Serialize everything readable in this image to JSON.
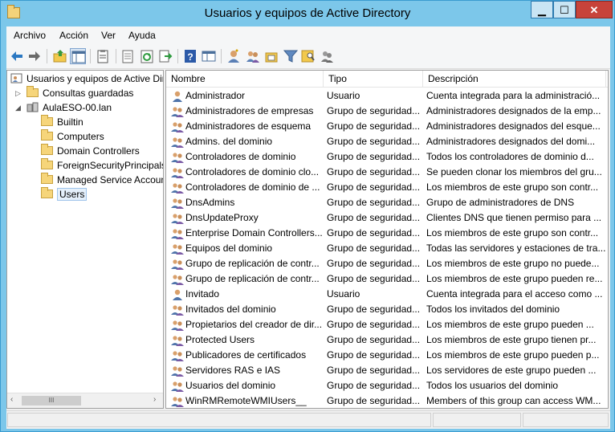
{
  "window": {
    "title": "Usuarios y equipos de Active Directory"
  },
  "menu": [
    "Archivo",
    "Acción",
    "Ver",
    "Ayuda"
  ],
  "toolbar": {
    "icons": [
      "back-icon",
      "forward-icon",
      "up-folder-icon",
      "show-tree-icon",
      "properties-icon",
      "export-list-icon",
      "refresh-icon",
      "export-icon",
      "help-icon",
      "console-icon",
      "new-user-icon",
      "new-group-icon",
      "new-ou-icon",
      "filter-icon",
      "find-icon",
      "add-to-group-icon"
    ]
  },
  "tree": {
    "root": "Usuarios y equipos de Active Dir",
    "saved_queries": "Consultas guardadas",
    "domain": "AulaESO-00.lan",
    "children": [
      "Builtin",
      "Computers",
      "Domain Controllers",
      "ForeignSecurityPrincipals",
      "Managed Service Accounts",
      "Users"
    ],
    "selected": "Users",
    "scroll_left": "‹",
    "scroll_right": "›",
    "scroll_grip": "III"
  },
  "list": {
    "columns": [
      "Nombre",
      "Tipo",
      "Descripción"
    ],
    "rows": [
      {
        "icon": "user-icon",
        "name": "Administrador",
        "type": "Usuario",
        "desc": "Cuenta integrada para la administració..."
      },
      {
        "icon": "group-icon",
        "name": "Administradores de empresas",
        "type": "Grupo de seguridad...",
        "desc": "Administradores designados de la emp..."
      },
      {
        "icon": "group-icon",
        "name": "Administradores de esquema",
        "type": "Grupo de seguridad...",
        "desc": "Administradores designados del esque..."
      },
      {
        "icon": "group-icon",
        "name": "Admins. del dominio",
        "type": "Grupo de seguridad...",
        "desc": "Administradores designados del domi..."
      },
      {
        "icon": "group-icon",
        "name": "Controladores de dominio",
        "type": "Grupo de seguridad...",
        "desc": "Todos los controladores de dominio d..."
      },
      {
        "icon": "group-icon",
        "name": "Controladores de dominio clo...",
        "type": "Grupo de seguridad...",
        "desc": "Se pueden clonar los miembros del gru..."
      },
      {
        "icon": "group-icon",
        "name": "Controladores de dominio de ...",
        "type": "Grupo de seguridad...",
        "desc": "Los miembros de este grupo son contr..."
      },
      {
        "icon": "group-icon",
        "name": "DnsAdmins",
        "type": "Grupo de seguridad...",
        "desc": "Grupo de administradores de DNS"
      },
      {
        "icon": "group-icon",
        "name": "DnsUpdateProxy",
        "type": "Grupo de seguridad...",
        "desc": "Clientes DNS que tienen permiso para ..."
      },
      {
        "icon": "group-icon",
        "name": "Enterprise Domain Controllers...",
        "type": "Grupo de seguridad...",
        "desc": "Los miembros de este grupo son contr..."
      },
      {
        "icon": "group-icon",
        "name": "Equipos del dominio",
        "type": "Grupo de seguridad...",
        "desc": "Todas las servidores y estaciones de tra..."
      },
      {
        "icon": "group-icon",
        "name": "Grupo de replicación de contr...",
        "type": "Grupo de seguridad...",
        "desc": "Los miembros de este grupo no puede..."
      },
      {
        "icon": "group-icon",
        "name": "Grupo de replicación de contr...",
        "type": "Grupo de seguridad...",
        "desc": "Los miembros de este grupo pueden re..."
      },
      {
        "icon": "user-icon",
        "name": "Invitado",
        "type": "Usuario",
        "desc": "Cuenta integrada para el acceso como ..."
      },
      {
        "icon": "group-icon",
        "name": "Invitados del dominio",
        "type": "Grupo de seguridad...",
        "desc": "Todos los invitados del dominio"
      },
      {
        "icon": "group-icon",
        "name": "Propietarios del creador de dir...",
        "type": "Grupo de seguridad...",
        "desc": "Los miembros de este grupo pueden ..."
      },
      {
        "icon": "group-icon",
        "name": "Protected Users",
        "type": "Grupo de seguridad...",
        "desc": "Los miembros de este grupo tienen pr..."
      },
      {
        "icon": "group-icon",
        "name": "Publicadores de certificados",
        "type": "Grupo de seguridad...",
        "desc": "Los miembros de este grupo pueden p..."
      },
      {
        "icon": "group-icon",
        "name": "Servidores RAS e IAS",
        "type": "Grupo de seguridad...",
        "desc": "Los servidores de este grupo pueden ..."
      },
      {
        "icon": "group-icon",
        "name": "Usuarios del dominio",
        "type": "Grupo de seguridad...",
        "desc": "Todos los usuarios del dominio"
      },
      {
        "icon": "group-icon",
        "name": "WinRMRemoteWMIUsers__",
        "type": "Grupo de seguridad...",
        "desc": "Members of this group can access WM..."
      }
    ]
  },
  "colors": {
    "titlebar": "#7cc7ea",
    "close": "#c7433a",
    "selection": "#e5f0fb"
  }
}
